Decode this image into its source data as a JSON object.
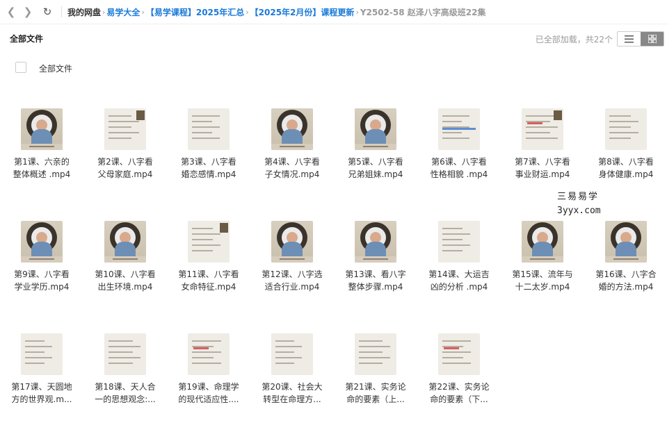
{
  "breadcrumb": {
    "root": "我的网盘",
    "items": [
      "易学大全",
      "【易学课程】2025年汇总",
      "【2025年2月份】课程更新"
    ],
    "current": "Y2502-58 赵泽八字高级班22集"
  },
  "toolbar": {
    "title": "全部文件",
    "status": "已全部加载，共22个",
    "view_mode": "grid"
  },
  "select_all_label": "全部文件",
  "files": [
    {
      "line1": "第1课、六亲的",
      "line2": "整体概述 .mp4",
      "thumb": "video"
    },
    {
      "line1": "第2课、八字看",
      "line2": "父母家庭.mp4",
      "thumb": "slide"
    },
    {
      "line1": "第3课、八字看",
      "line2": "婚恋感情.mp4",
      "thumb": "slide"
    },
    {
      "line1": "第4课、八字看",
      "line2": "子女情况.mp4",
      "thumb": "video"
    },
    {
      "line1": "第5课、八字看",
      "line2": "兄弟姐妹.mp4",
      "thumb": "video"
    },
    {
      "line1": "第6课、八字看",
      "line2": "性格相貌 .mp4",
      "thumb": "slide"
    },
    {
      "line1": "第7课、八字看",
      "line2": "事业财运.mp4",
      "thumb": "slide"
    },
    {
      "line1": "第8课、八字看",
      "line2": "身体健康.mp4",
      "thumb": "slide"
    },
    {
      "line1": "第9课、八字看",
      "line2": "学业学历.mp4",
      "thumb": "video"
    },
    {
      "line1": "第10课、八字看",
      "line2": "出生环境.mp4",
      "thumb": "video"
    },
    {
      "line1": "第11课、八字看",
      "line2": "女命特征.mp4",
      "thumb": "slide"
    },
    {
      "line1": "第12课、八字选",
      "line2": "适合行业.mp4",
      "thumb": "video"
    },
    {
      "line1": "第13课、看八字",
      "line2": "整体步骤.mp4",
      "thumb": "video"
    },
    {
      "line1": "第14课、大运吉",
      "line2": "凶的分析 .mp4",
      "thumb": "slide"
    },
    {
      "line1": "第15课、流年与",
      "line2": "十二太岁.mp4",
      "thumb": "video"
    },
    {
      "line1": "第16课、八字合",
      "line2": "婚的方法.mp4",
      "thumb": "video"
    },
    {
      "line1": "第17课、天圆地",
      "line2": "方的世界观.m...",
      "thumb": "slide"
    },
    {
      "line1": "第18课、天人合",
      "line2": "一的思想观念:...",
      "thumb": "slide"
    },
    {
      "line1": "第19课、命理学",
      "line2": "的现代适应性....",
      "thumb": "slide"
    },
    {
      "line1": "第20课、社会大",
      "line2": "转型在命理方...",
      "thumb": "slide"
    },
    {
      "line1": "第21课、实务论",
      "line2": "命的要素（上...",
      "thumb": "slide"
    },
    {
      "line1": "第22课、实务论",
      "line2": "命的要素（下...",
      "thumb": "slide"
    }
  ],
  "watermark": {
    "line1": "三易易学",
    "line2": "3yyx.com"
  }
}
